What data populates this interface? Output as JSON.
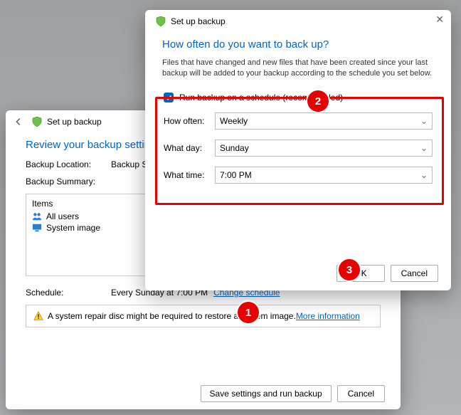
{
  "win1": {
    "title": "Set up backup",
    "heading": "Review your backup settings",
    "loc_label": "Backup Location:",
    "loc_value": "Backup SSD (F:)",
    "summary_label": "Backup Summary:",
    "items_header": "Items",
    "item_all_users": "All users",
    "item_system_image": "System image",
    "schedule_label": "Schedule:",
    "schedule_value": "Every Sunday at 7:00 PM",
    "change_schedule": "Change schedule",
    "warn_text": "A system repair disc might be required to restore a system image. ",
    "warn_link": "More information",
    "btn_save": "Save settings and run backup",
    "btn_cancel": "Cancel"
  },
  "win2": {
    "title": "Set up backup",
    "heading": "How often do you want to back up?",
    "desc": "Files that have changed and new files that have been created since your last backup will be added to your backup according to the schedule you set below.",
    "chk_label": "Run backup on a schedule (recommended)",
    "how_often_label": "How often:",
    "how_often_value": "Weekly",
    "what_day_label": "What day:",
    "what_day_value": "Sunday",
    "what_time_label": "What time:",
    "what_time_value": "7:00 PM",
    "btn_ok": "OK",
    "btn_cancel": "Cancel"
  },
  "callouts": {
    "c1": "1",
    "c2": "2",
    "c3": "3"
  }
}
